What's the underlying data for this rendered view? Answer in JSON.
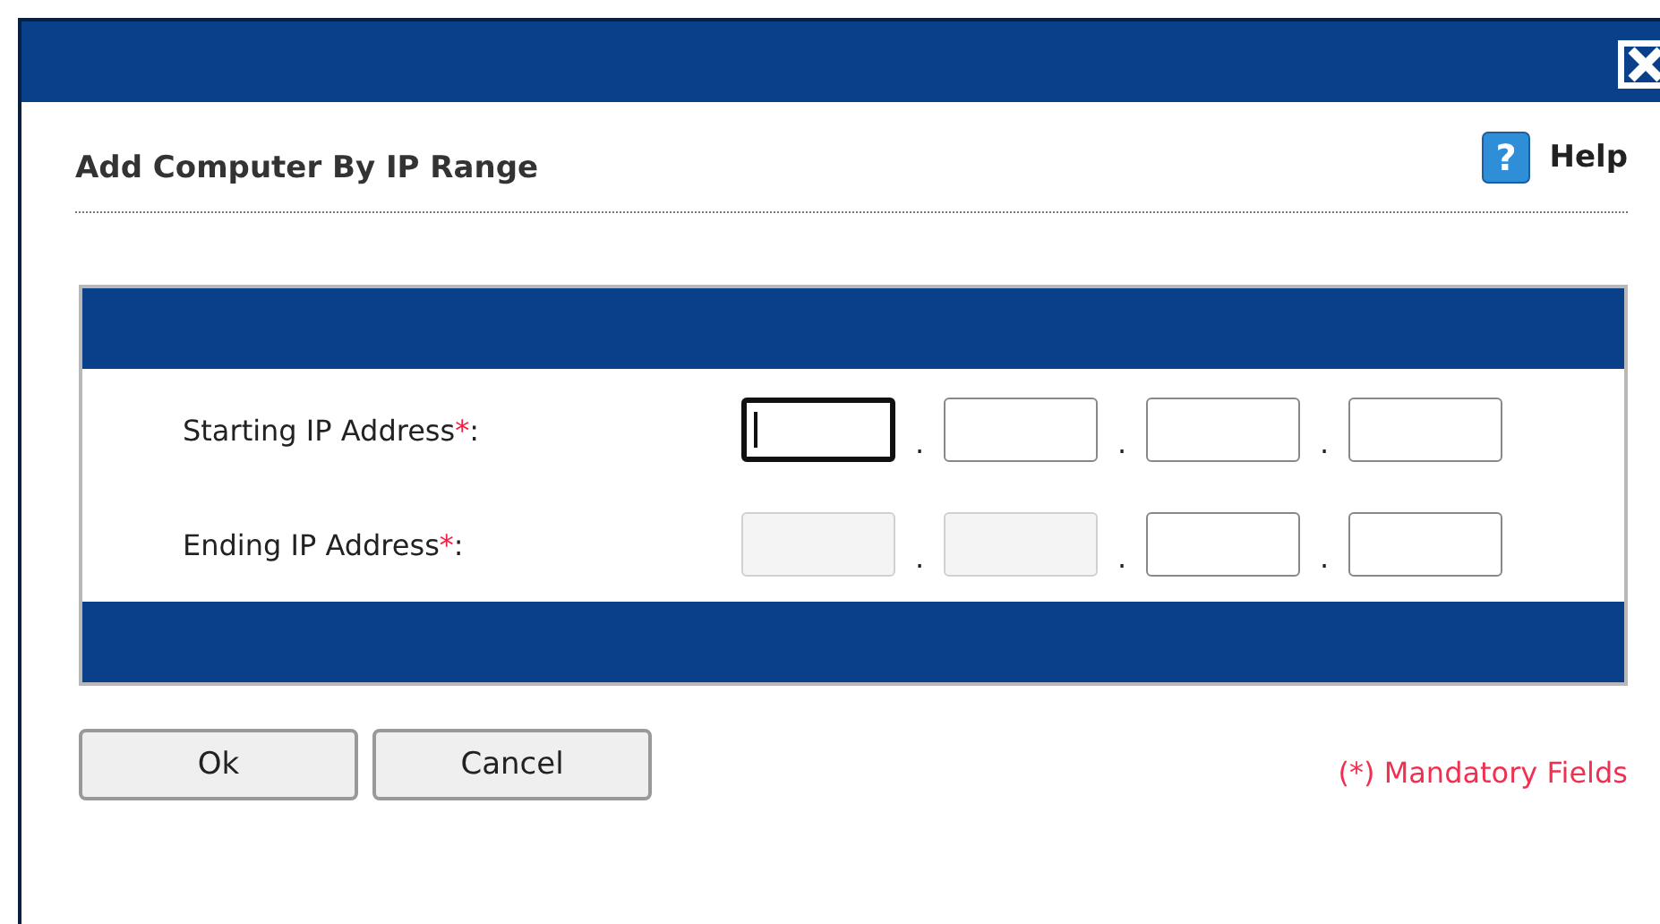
{
  "dialog": {
    "title": "Add Computer By IP Range",
    "help_icon": "?",
    "help": "Help"
  },
  "rows": [
    {
      "label": "Starting IP Address",
      "required_mark": "*",
      "suffix": ":",
      "octets": [
        {
          "disabled": false,
          "focused": true
        },
        {
          "disabled": false,
          "focused": false
        },
        {
          "disabled": false,
          "focused": false
        },
        {
          "disabled": false,
          "focused": false
        }
      ],
      "separators": [
        ".",
        ".",
        "."
      ]
    },
    {
      "label": "Ending IP Address",
      "required_mark": "*",
      "suffix": ":",
      "octets": [
        {
          "disabled": true,
          "focused": false
        },
        {
          "disabled": true,
          "focused": false
        },
        {
          "disabled": false,
          "focused": false
        },
        {
          "disabled": false,
          "focused": false
        }
      ],
      "separators": [
        ".",
        ".",
        "."
      ]
    }
  ],
  "buttons": [
    "Ok",
    "Cancel"
  ],
  "mandatory_note": "(*) Mandatory Fields"
}
